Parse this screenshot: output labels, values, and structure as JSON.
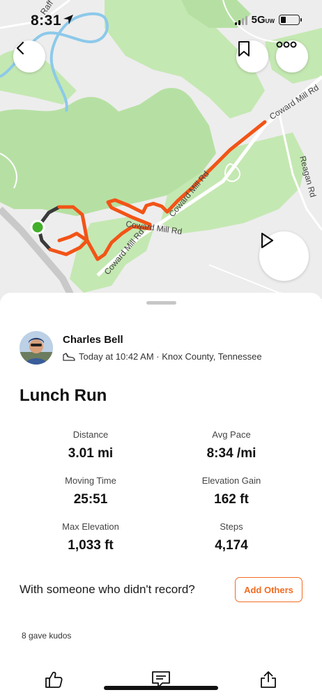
{
  "status_bar": {
    "time": "8:31",
    "network": "5G",
    "network_sub": "UW"
  },
  "map": {
    "road_labels": [
      "Coward Mill Rd",
      "Coward Mill Rd",
      "Coward Mill Rd",
      "Coward Mill Rd",
      "Reagan Rd",
      "Raff"
    ],
    "route_color": "#f25417",
    "start_color": "#43b02a"
  },
  "icons": {
    "back": "chevron-left-icon",
    "bookmark": "bookmark-icon",
    "more": "more-dots-icon",
    "play": "play-icon",
    "shoe": "shoe-icon",
    "kudos": "thumbs-up-icon",
    "comment": "comment-icon",
    "share": "share-icon"
  },
  "athlete": {
    "name": "Charles Bell",
    "meta": "Today at 10:42 AM · Knox County, Tennessee"
  },
  "activity": {
    "title": "Lunch Run",
    "stats": [
      {
        "label": "Distance",
        "value": "3.01 mi"
      },
      {
        "label": "Avg Pace",
        "value": "8:34 /mi"
      },
      {
        "label": "Moving Time",
        "value": "25:51"
      },
      {
        "label": "Elevation Gain",
        "value": "162 ft"
      },
      {
        "label": "Max Elevation",
        "value": "1,033 ft"
      },
      {
        "label": "Steps",
        "value": "4,174"
      }
    ]
  },
  "with_others": {
    "question": "With someone who didn't record?",
    "button": "Add Others"
  },
  "kudos_text": "8 gave kudos",
  "colors": {
    "accent": "#f26b21"
  }
}
